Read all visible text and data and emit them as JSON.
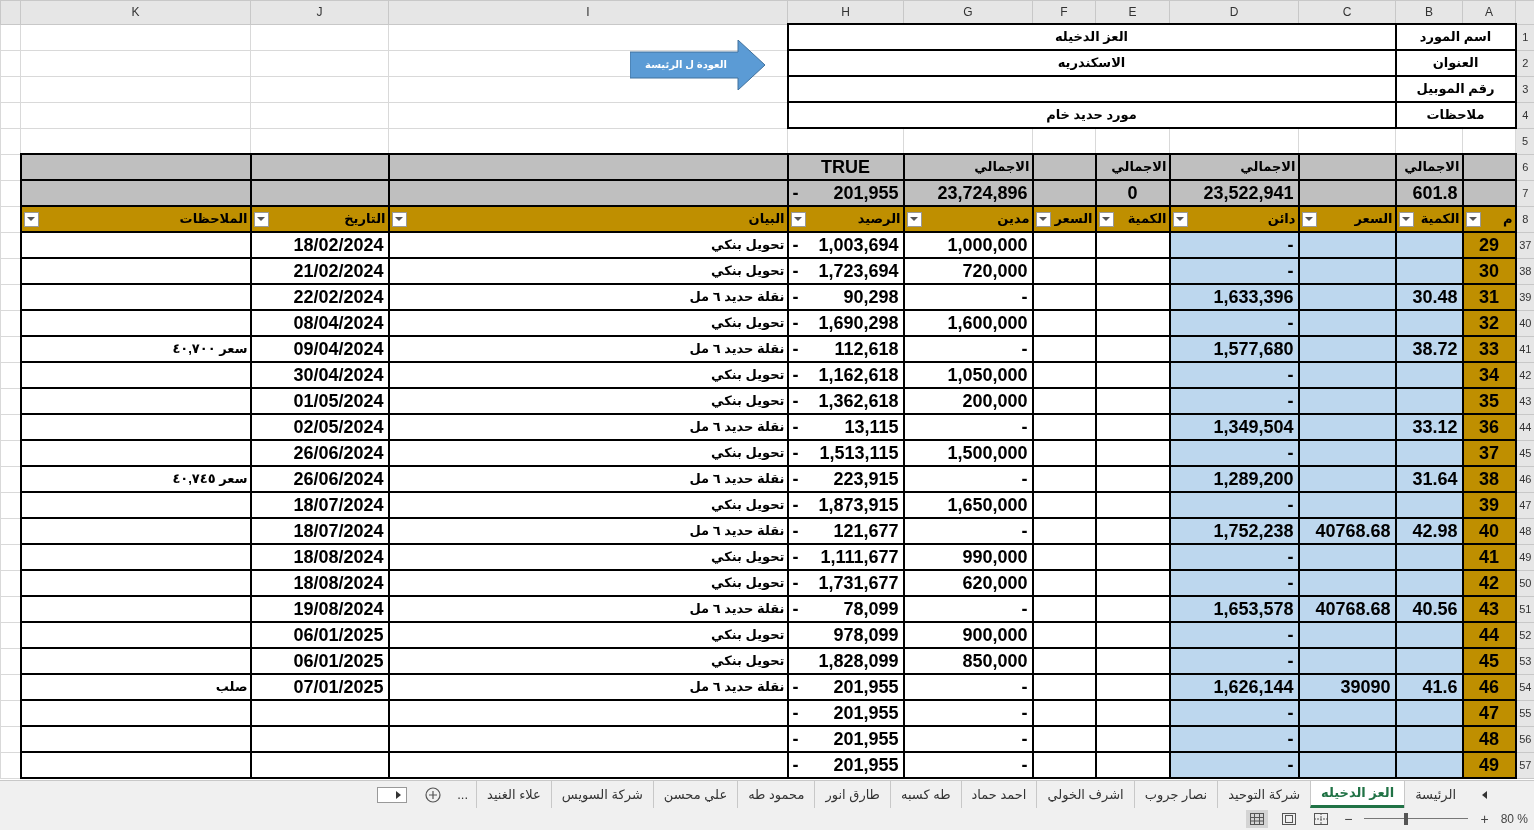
{
  "column_letters": [
    "A",
    "B",
    "C",
    "D",
    "E",
    "F",
    "G",
    "H",
    "I",
    "J",
    "K"
  ],
  "supplier_info": [
    {
      "row_number": "1",
      "label": "اسم المورد",
      "value": "العز الدخيله"
    },
    {
      "row_number": "2",
      "label": "العنوان",
      "value": "الاسكندريه"
    },
    {
      "row_number": "3",
      "label": "رقم الموبيل"
    },
    {
      "row_number": "4",
      "label": "ملاحظات",
      "value": "مورد حديد خام"
    }
  ],
  "back_button": {
    "label": "العودة ل الرئيسة"
  },
  "empty_row_number": "5",
  "summary_rows": [
    {
      "row_number": "6",
      "cells": {
        "B": "الاجمالي",
        "D": "الاجمالي",
        "E": "الاجمالي",
        "G": "الاجمالي",
        "H": "TRUE"
      },
      "balance_sign": ""
    },
    {
      "row_number": "7",
      "cells": {
        "B": "601.8",
        "D": "23,522,941",
        "E": "0",
        "G": "23,724,896",
        "H": "201,955"
      },
      "balance_sign": "-"
    }
  ],
  "header_row": {
    "row_number": "8",
    "cells": {
      "A": "م",
      "B": "الكمية",
      "C": "السعر",
      "D": "دائن",
      "E": "الكمية",
      "F": "السعر",
      "G": "مدين",
      "H": "الرصيد",
      "I": "البيان",
      "J": "التاريخ",
      "K": "الملاحظات"
    }
  },
  "rows": [
    {
      "row_number": "37",
      "balance_sign": "-",
      "cells": {
        "A": "29",
        "D": "-",
        "G": "1,000,000",
        "H": "1,003,694",
        "I": "تحويل بنكي",
        "J": "18/02/2024"
      }
    },
    {
      "row_number": "38",
      "balance_sign": "-",
      "cells": {
        "A": "30",
        "D": "-",
        "G": "720,000",
        "H": "1,723,694",
        "I": "تحويل بنكي",
        "J": "21/02/2024"
      }
    },
    {
      "row_number": "39",
      "balance_sign": "-",
      "cells": {
        "A": "31",
        "B": "30.48",
        "D": "1,633,396",
        "G": "-",
        "H": "90,298",
        "I": "نقلة حديد ٦ مل",
        "J": "22/02/2024"
      }
    },
    {
      "row_number": "40",
      "balance_sign": "-",
      "cells": {
        "A": "32",
        "D": "-",
        "G": "1,600,000",
        "H": "1,690,298",
        "I": "تحويل بنكي",
        "J": "08/04/2024"
      }
    },
    {
      "row_number": "41",
      "balance_sign": "-",
      "cells": {
        "A": "33",
        "B": "38.72",
        "D": "1,577,680",
        "G": "-",
        "H": "112,618",
        "I": "نقلة حديد ٦ مل",
        "J": "09/04/2024",
        "K": "سعر ٤٠,٧٠٠"
      }
    },
    {
      "row_number": "42",
      "balance_sign": "-",
      "cells": {
        "A": "34",
        "D": "-",
        "G": "1,050,000",
        "H": "1,162,618",
        "I": "تحويل بنكي",
        "J": "30/04/2024"
      }
    },
    {
      "row_number": "43",
      "balance_sign": "-",
      "cells": {
        "A": "35",
        "D": "-",
        "G": "200,000",
        "H": "1,362,618",
        "I": "تحويل بنكي",
        "J": "01/05/2024"
      }
    },
    {
      "row_number": "44",
      "balance_sign": "-",
      "cells": {
        "A": "36",
        "B": "33.12",
        "D": "1,349,504",
        "G": "-",
        "H": "13,115",
        "I": "نقلة حديد ٦ مل",
        "J": "02/05/2024"
      }
    },
    {
      "row_number": "45",
      "balance_sign": "-",
      "cells": {
        "A": "37",
        "D": "-",
        "G": "1,500,000",
        "H": "1,513,115",
        "I": "تحويل بنكي",
        "J": "26/06/2024"
      }
    },
    {
      "row_number": "46",
      "balance_sign": "-",
      "cells": {
        "A": "38",
        "B": "31.64",
        "D": "1,289,200",
        "G": "-",
        "H": "223,915",
        "I": "نقلة حديد ٦ مل",
        "J": "26/06/2024",
        "K": "سعر ٤٠,٧٤٥"
      }
    },
    {
      "row_number": "47",
      "balance_sign": "-",
      "cells": {
        "A": "39",
        "D": "-",
        "G": "1,650,000",
        "H": "1,873,915",
        "I": "تحويل بنكي",
        "J": "18/07/2024"
      }
    },
    {
      "row_number": "48",
      "balance_sign": "-",
      "cells": {
        "A": "40",
        "B": "42.98",
        "C": "40768.68",
        "D": "1,752,238",
        "G": "-",
        "H": "121,677",
        "I": "نقلة حديد ٦ مل",
        "J": "18/07/2024"
      }
    },
    {
      "row_number": "49",
      "balance_sign": "-",
      "cells": {
        "A": "41",
        "D": "-",
        "G": "990,000",
        "H": "1,111,677",
        "I": "تحويل بنكي",
        "J": "18/08/2024"
      }
    },
    {
      "row_number": "50",
      "balance_sign": "-",
      "cells": {
        "A": "42",
        "D": "-",
        "G": "620,000",
        "H": "1,731,677",
        "I": "تحويل بنكي",
        "J": "18/08/2024"
      }
    },
    {
      "row_number": "51",
      "balance_sign": "-",
      "cells": {
        "A": "43",
        "B": "40.56",
        "C": "40768.68",
        "D": "1,653,578",
        "G": "-",
        "H": "78,099",
        "I": "نقلة حديد ٦ مل",
        "J": "19/08/2024"
      }
    },
    {
      "row_number": "52",
      "balance_sign": "",
      "cells": {
        "A": "44",
        "D": "-",
        "G": "900,000",
        "H": "978,099",
        "I": "تحويل بنكي",
        "J": "06/01/2025"
      }
    },
    {
      "row_number": "53",
      "balance_sign": "",
      "cells": {
        "A": "45",
        "D": "-",
        "G": "850,000",
        "H": "1,828,099",
        "I": "تحويل بنكي",
        "J": "06/01/2025"
      }
    },
    {
      "row_number": "54",
      "balance_sign": "-",
      "cells": {
        "A": "46",
        "B": "41.6",
        "C": "39090",
        "D": "1,626,144",
        "G": "-",
        "H": "201,955",
        "I": "نقلة حديد ٦ مل",
        "J": "07/01/2025",
        "K": "صلب"
      }
    },
    {
      "row_number": "55",
      "balance_sign": "-",
      "cells": {
        "A": "47",
        "D": "-",
        "G": "-",
        "H": "201,955"
      }
    },
    {
      "row_number": "56",
      "balance_sign": "-",
      "cells": {
        "A": "48",
        "D": "-",
        "G": "-",
        "H": "201,955"
      }
    },
    {
      "row_number": "57",
      "balance_sign": "-",
      "cells": {
        "A": "49",
        "D": "-",
        "G": "-",
        "H": "201,955"
      }
    }
  ],
  "sheet_tabs": [
    {
      "label": "الرئيسة",
      "selected": false
    },
    {
      "label": "العز الدخيله",
      "selected": true
    },
    {
      "label": "شركة التوحيد",
      "selected": false
    },
    {
      "label": "نصار جروب",
      "selected": false
    },
    {
      "label": "اشرف الخولي",
      "selected": false
    },
    {
      "label": "احمد حماد",
      "selected": false
    },
    {
      "label": "طه كسبه",
      "selected": false
    },
    {
      "label": "طارق انور",
      "selected": false
    },
    {
      "label": "محمود طه",
      "selected": false
    },
    {
      "label": "علي محسن",
      "selected": false
    },
    {
      "label": "شركة السويس",
      "selected": false
    },
    {
      "label": "علاء الغنيد",
      "selected": false
    }
  ],
  "more_tabs": "...",
  "status_bar": {
    "zoom_out": "−",
    "zoom_in": "+",
    "zoom_slider": {
      "level": 0.4
    },
    "zoom_percent": "80 %"
  }
}
